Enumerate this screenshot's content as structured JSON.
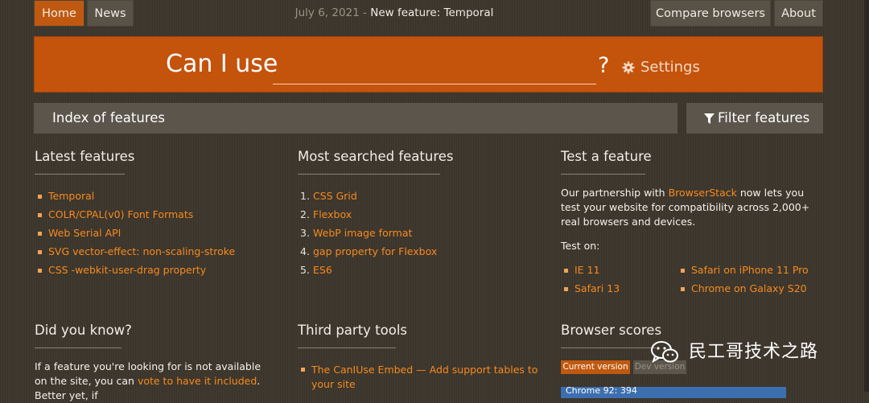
{
  "nav": {
    "home": "Home",
    "news": "News",
    "compare": "Compare browsers",
    "about": "About"
  },
  "ticker": {
    "date": "July 6, 2021",
    "separator": "-",
    "message": "New feature: Temporal"
  },
  "hero": {
    "title": "Can I use",
    "search_value": "",
    "question": "?",
    "settings": "Settings"
  },
  "index_bar": {
    "label": "Index of features",
    "filter": "Filter features"
  },
  "latest": {
    "title": "Latest features",
    "items": [
      "Temporal",
      "COLR/CPAL(v0) Font Formats",
      "Web Serial API",
      "SVG vector-effect: non-scaling-stroke",
      "CSS -webkit-user-drag property"
    ]
  },
  "most_searched": {
    "title": "Most searched features",
    "items": [
      {
        "num": "1.",
        "label": "CSS Grid"
      },
      {
        "num": "2.",
        "label": "Flexbox"
      },
      {
        "num": "3.",
        "label": "WebP image format"
      },
      {
        "num": "4.",
        "label": "gap property for Flexbox"
      },
      {
        "num": "5.",
        "label": "ES6"
      }
    ]
  },
  "test_feature": {
    "title": "Test a feature",
    "text_before": "Our partnership with",
    "link": "BrowserStack",
    "text_after": "now lets you test your website for compatibility across 2,000+ real browsers and devices.",
    "test_on": "Test on:",
    "browsers": [
      "IE 11",
      "Safari 13",
      "Safari on iPhone 11 Pro",
      "Chrome on Galaxy S20"
    ]
  },
  "did_you_know": {
    "title": "Did you know?",
    "text_before": "If a feature you're looking for is not available on the site, you can",
    "link": "vote to have it included",
    "text_after": ". Better yet, if"
  },
  "third_party": {
    "title": "Third party tools",
    "items": [
      "The CanIUse Embed — Add support tables to your site"
    ]
  },
  "browser_scores": {
    "title": "Browser scores",
    "current": "Current version",
    "dev": "Dev version",
    "first_score": "Chrome 92: 394"
  },
  "watermark": {
    "text": "民工哥技术之路",
    "icon": "wechat-icon"
  },
  "colors": {
    "accent": "#c4530c",
    "link": "#f58a20",
    "background": "#3d362c",
    "bar": "#5b554b"
  }
}
